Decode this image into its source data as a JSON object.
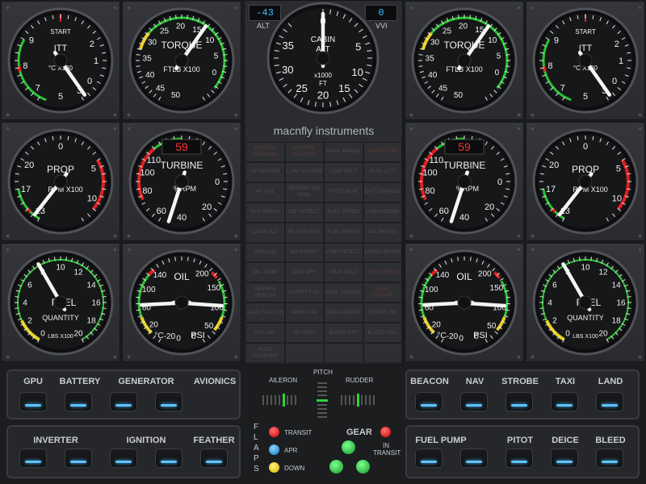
{
  "brand": "macnfly instruments",
  "alt_display": "-43",
  "alt_label": "ALT",
  "vvi_display": "0",
  "vvi_label": "VVI",
  "cabin_alt": {
    "title1": "CABIN",
    "title2": "ALT",
    "unit1": "x1000",
    "unit2": "FT",
    "ticks": [
      "0",
      "5",
      "10",
      "15",
      "20",
      "25",
      "30",
      "35"
    ]
  },
  "itt": {
    "title": "ITT",
    "start": "START",
    "unit": "°C X100",
    "ticks": [
      "0",
      "1",
      "2",
      "3",
      "5",
      "7",
      "8",
      "9"
    ]
  },
  "torque": {
    "title": "TORQUE",
    "unit": "FTLB X100",
    "ticks": [
      "0",
      "5",
      "10",
      "15",
      "20",
      "25",
      "30",
      "35",
      "40",
      "45",
      "50"
    ]
  },
  "prop": {
    "title": "PROP",
    "unit": "RPM X100",
    "ticks": [
      "0",
      "5",
      "10",
      "13",
      "17",
      "20"
    ]
  },
  "turbine": {
    "title": "TURBINE",
    "unit": "%RPM",
    "display": "59",
    "ticks": [
      "0",
      "20",
      "40",
      "60",
      "80",
      "100",
      "110"
    ]
  },
  "fuel": {
    "title": "FUEL",
    "sub": "QUANTITY",
    "unit": "LBS X100",
    "ticks": [
      "0",
      "2",
      "4",
      "6",
      "8",
      "10",
      "12",
      "14",
      "16",
      "18",
      "20"
    ]
  },
  "oil": {
    "title": "OIL",
    "unit_c": "°C",
    "unit_p": "PSI",
    "temp_ticks": [
      "-20",
      "0",
      "20",
      "60",
      "100",
      "140"
    ],
    "psi_ticks": [
      "0",
      "50",
      "100",
      "150",
      "200"
    ]
  },
  "annunciators": [
    "MASTER WARNING",
    "MASTER CAUTION",
    "PARK BRAKE",
    "SMOKE FIRE",
    "AP DISCON",
    "LOW VACUUM",
    "LOW VOLT",
    "FUEL QTY",
    "AP FAIL",
    "REVERS NO AVAIL",
    "PITOT HEAT",
    "BATT CHARGE",
    "HYD PRESS",
    "ICE DETECT",
    "FUEL XFEED",
    "CABIN DOOR",
    "CABIN ALT",
    "AP TRIM FAIL",
    "FUEL PRESS",
    "OIL PRESS",
    "GPU ON",
    "NO INVERT",
    "CHIP DETECT",
    "SPEED BRAKE",
    "OIL TEMP",
    "GEN OFF",
    "SEAT BELT",
    "OVER SPEED",
    "REVERS DEPLOY",
    "INVERT FAIL",
    "FUEL TRANSF",
    "GEAR UNSAFE",
    "LAND TAXI LTS",
    "GPWS FAIL",
    "YAW DAMPER",
    "IGNITE ON",
    "N1 LOW",
    "N1 HIGH",
    "BLEED OFF",
    "BLEED FAIL",
    "AUTO FEATHER",
    "",
    "",
    ""
  ],
  "switches_left_top": [
    "GPU",
    "BATTERY",
    "GENERATOR",
    "AVIONICS"
  ],
  "switches_left_bottom": [
    "INVERTER",
    "IGNITION",
    "FEATHER"
  ],
  "switches_right_top": [
    "BEACON",
    "NAV",
    "STROBE",
    "TAXI",
    "LAND"
  ],
  "switches_right_bottom": [
    "FUEL PUMP",
    "PITOT",
    "DEICE",
    "BLEED"
  ],
  "trim": {
    "aileron": "AILERON",
    "pitch": "PITCH",
    "rudder": "RUDDER"
  },
  "flaps": {
    "letters": [
      "F",
      "L",
      "A",
      "P",
      "S"
    ],
    "transit": "TRANSIT",
    "apr": "APR",
    "down": "DOWN"
  },
  "gear": {
    "title": "GEAR",
    "in": "IN",
    "transit": "TRANSIT"
  },
  "colors": {
    "switch_light": "#5fc4ff",
    "lamp_red": "#e01818",
    "lamp_blue": "#1e9ee8",
    "lamp_yellow": "#f0d000",
    "lamp_green": "#22c53a"
  }
}
